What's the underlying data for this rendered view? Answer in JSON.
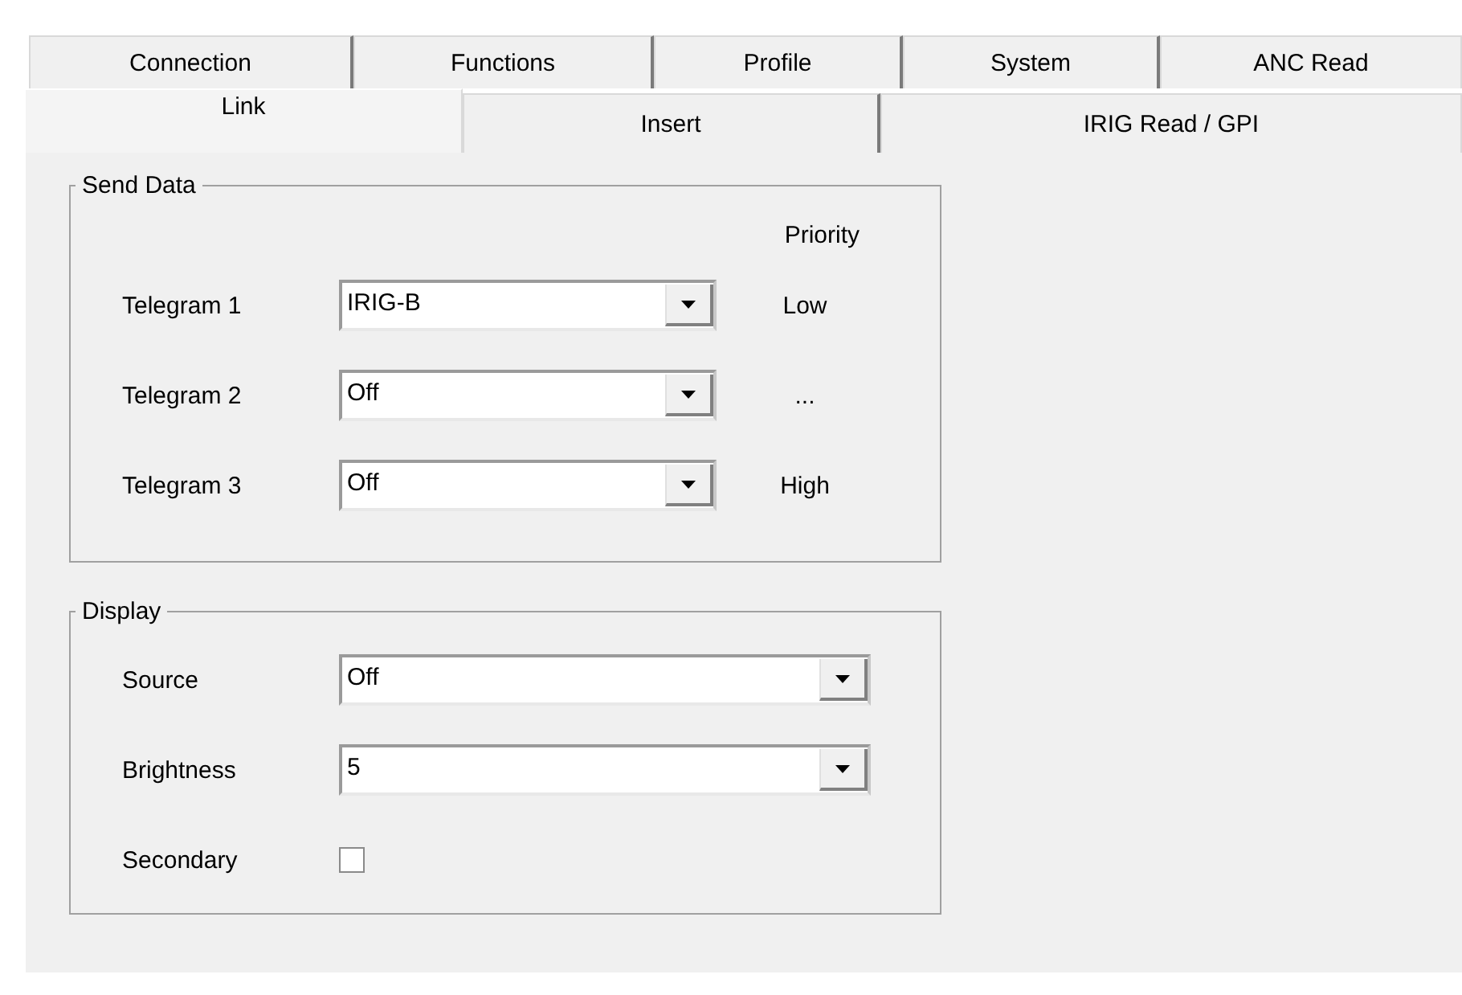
{
  "tabs": {
    "back_row": [
      {
        "label": "Connection",
        "selected": false
      },
      {
        "label": "Functions",
        "selected": false
      },
      {
        "label": "Profile",
        "selected": false
      },
      {
        "label": "System",
        "selected": false
      },
      {
        "label": "ANC Read",
        "selected": false
      }
    ],
    "front_row": [
      {
        "label": "Link",
        "selected": true
      },
      {
        "label": "Insert",
        "selected": false
      },
      {
        "label": "IRIG Read / GPI",
        "selected": false
      }
    ]
  },
  "send_data": {
    "title": "Send Data",
    "priority_header": "Priority",
    "telegrams": [
      {
        "label": "Telegram 1",
        "value": "IRIG-B",
        "priority": "Low"
      },
      {
        "label": "Telegram 2",
        "value": "Off",
        "priority": "..."
      },
      {
        "label": "Telegram 3",
        "value": "Off",
        "priority": "High"
      }
    ]
  },
  "display": {
    "title": "Display",
    "rows": [
      {
        "kind": "combo",
        "label": "Source",
        "value": "Off"
      },
      {
        "kind": "combo",
        "label": "Brightness",
        "value": "5"
      },
      {
        "kind": "checkbox",
        "label": "Secondary",
        "checked": false
      }
    ]
  }
}
